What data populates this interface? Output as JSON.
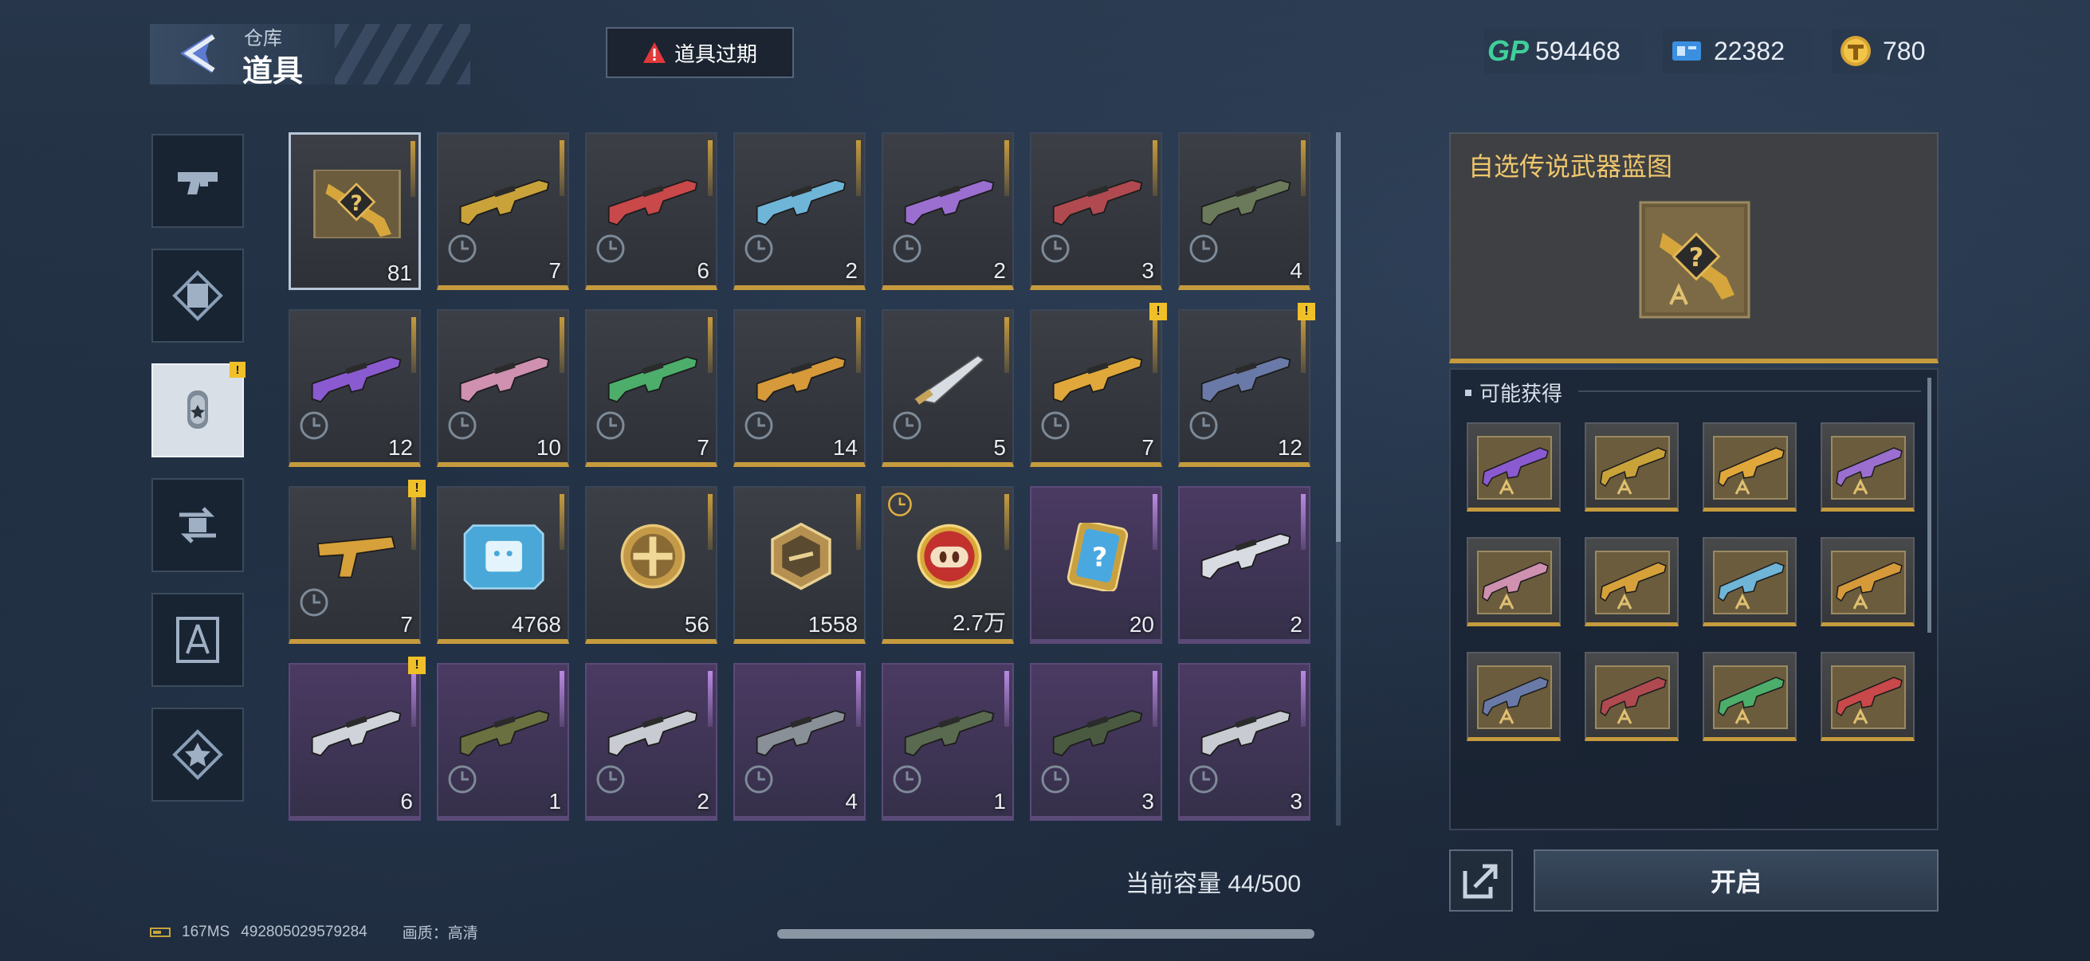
{
  "header": {
    "breadcrumb": "仓库",
    "title": "道具",
    "expire_button": "道具过期"
  },
  "currencies": [
    {
      "name": "GP",
      "icon": "gp-icon",
      "value": "594468"
    },
    {
      "name": "ticket",
      "icon": "ticket-icon",
      "value": "22382"
    },
    {
      "name": "coin",
      "icon": "t-coin-icon",
      "value": "780"
    }
  ],
  "categories": [
    {
      "name": "pistol-icon",
      "active": false,
      "badge": ""
    },
    {
      "name": "scroll-card-icon",
      "active": false,
      "badge": ""
    },
    {
      "name": "dogtag-icon",
      "active": true,
      "badge": "!"
    },
    {
      "name": "exchange-icon",
      "active": false,
      "badge": ""
    },
    {
      "name": "blueprint-icon",
      "active": false,
      "badge": ""
    },
    {
      "name": "star-badge-icon",
      "active": false,
      "badge": ""
    }
  ],
  "items": [
    {
      "kind": "mystery-blueprint",
      "rarity": "gold",
      "count": "81",
      "selected": true,
      "badge": "",
      "clock": false,
      "color": "#d6a63c"
    },
    {
      "kind": "rifle",
      "rarity": "gold",
      "count": "7",
      "badge": "",
      "clock": true,
      "color": "#c9a33a"
    },
    {
      "kind": "rifle",
      "rarity": "gold",
      "count": "6",
      "badge": "",
      "clock": true,
      "color": "#c9484a"
    },
    {
      "kind": "rifle",
      "rarity": "gold",
      "count": "2",
      "badge": "",
      "clock": true,
      "color": "#6fb5d8"
    },
    {
      "kind": "rifle",
      "rarity": "gold",
      "count": "2",
      "badge": "",
      "clock": true,
      "color": "#9a6fd0"
    },
    {
      "kind": "rifle",
      "rarity": "gold",
      "count": "3",
      "badge": "",
      "clock": true,
      "color": "#b04a50"
    },
    {
      "kind": "rifle",
      "rarity": "gold",
      "count": "4",
      "badge": "",
      "clock": true,
      "color": "#6a7a5a"
    },
    {
      "kind": "rifle",
      "rarity": "gold",
      "count": "12",
      "badge": "",
      "clock": true,
      "color": "#8a5ad0"
    },
    {
      "kind": "rifle",
      "rarity": "gold",
      "count": "10",
      "badge": "",
      "clock": true,
      "color": "#d090b0"
    },
    {
      "kind": "rifle",
      "rarity": "gold",
      "count": "7",
      "badge": "",
      "clock": true,
      "color": "#4cae6a"
    },
    {
      "kind": "rifle",
      "rarity": "gold",
      "count": "14",
      "badge": "",
      "clock": true,
      "color": "#d69a3a"
    },
    {
      "kind": "knife",
      "rarity": "gold",
      "count": "5",
      "badge": "",
      "clock": true,
      "color": "#c7a35a"
    },
    {
      "kind": "rifle",
      "rarity": "gold",
      "count": "7",
      "badge": "!",
      "clock": true,
      "color": "#e0a83a"
    },
    {
      "kind": "rifle",
      "rarity": "gold",
      "count": "12",
      "badge": "!",
      "clock": true,
      "color": "#6a7aa8"
    },
    {
      "kind": "pistol",
      "rarity": "gold",
      "count": "7",
      "badge": "!",
      "clock": true,
      "color": "#d6a03a"
    },
    {
      "kind": "chip-card",
      "rarity": "gold",
      "count": "4768",
      "badge": "",
      "clock": false,
      "color": "#4aa8d8"
    },
    {
      "kind": "cross-coin",
      "rarity": "gold",
      "count": "56",
      "badge": "",
      "clock": false,
      "color": "#c49a48"
    },
    {
      "kind": "hex-badge",
      "rarity": "gold",
      "count": "1558",
      "badge": "",
      "clock": false,
      "color": "#b59050"
    },
    {
      "kind": "pig-coin",
      "rarity": "gold",
      "count": "2.7万",
      "badge": "",
      "clock": true,
      "clock_top": true,
      "color": "#c2312e"
    },
    {
      "kind": "mystery-phone",
      "rarity": "purple",
      "count": "20",
      "badge": "",
      "clock": false,
      "color": "#4aa8e0"
    },
    {
      "kind": "rifle",
      "rarity": "purple",
      "count": "2",
      "badge": "",
      "clock": false,
      "color": "#d8dce2"
    },
    {
      "kind": "rifle",
      "rarity": "purple",
      "count": "6",
      "badge": "!",
      "clock": false,
      "color": "#d0d4da"
    },
    {
      "kind": "rifle",
      "rarity": "purple",
      "count": "1",
      "badge": "",
      "clock": true,
      "color": "#6a7040"
    },
    {
      "kind": "rifle",
      "rarity": "purple",
      "count": "2",
      "badge": "",
      "clock": true,
      "color": "#c8ccd2"
    },
    {
      "kind": "rifle",
      "rarity": "purple",
      "count": "4",
      "badge": "",
      "clock": true,
      "color": "#8a9098"
    },
    {
      "kind": "rifle",
      "rarity": "purple",
      "count": "1",
      "badge": "",
      "clock": true,
      "color": "#5a6a50"
    },
    {
      "kind": "rifle",
      "rarity": "purple",
      "count": "3",
      "badge": "",
      "clock": true,
      "color": "#4a5a40"
    },
    {
      "kind": "rifle",
      "rarity": "purple",
      "count": "3",
      "badge": "",
      "clock": true,
      "color": "#c8ccd2"
    }
  ],
  "capacity_label": "当前容量 44/500",
  "status": {
    "ping": "167MS",
    "uid": "492805029579284",
    "quality": "画质：高清"
  },
  "detail": {
    "title": "自选传说武器蓝图",
    "may_get_label": "可能获得",
    "rewards": [
      {
        "color": "#8a5ad0"
      },
      {
        "color": "#c9a33a"
      },
      {
        "color": "#e0a83a"
      },
      {
        "color": "#9a6fd0"
      },
      {
        "color": "#d090b0"
      },
      {
        "color": "#d6a03a"
      },
      {
        "color": "#6fb5d8"
      },
      {
        "color": "#d69a3a"
      },
      {
        "color": "#6a7aa8"
      },
      {
        "color": "#b04a50"
      },
      {
        "color": "#4cae6a"
      },
      {
        "color": "#c9484a"
      }
    ],
    "open_button": "开启"
  },
  "colors": {
    "gold_accent": "#c69b3d",
    "purple_accent": "#a66ad0",
    "warning": "#e2383a",
    "gp_green": "#3fcf9a"
  }
}
